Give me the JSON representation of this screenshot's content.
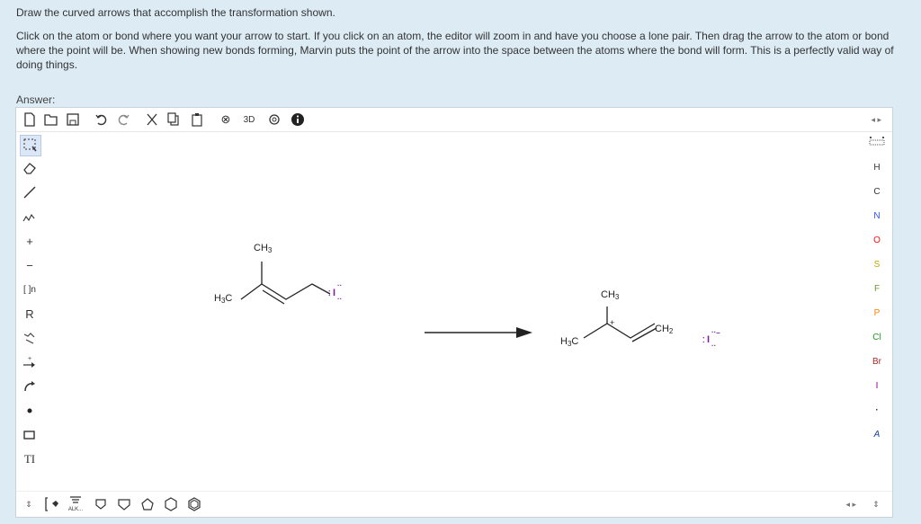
{
  "question": {
    "line1": "Draw the curved arrows that accomplish the transformation shown.",
    "line2": "Click on the atom or bond where you want your arrow to start. If you click on an atom, the editor will zoom in and have you choose a lone pair. Then drag the arrow to the atom or bond where the point will be. When showing new bonds forming, Marvin puts the point of the arrow into the space between the atoms where the bond will form. This is a perfectly valid way of doing things."
  },
  "answer_label": "Answer:",
  "toolbar": {
    "icons": [
      "new-document-icon",
      "open-folder-icon",
      "save-icon",
      "undo-icon",
      "redo-icon",
      "cut-icon",
      "copy-icon",
      "paste-icon",
      "zoom-icon",
      "3d-icon",
      "settings-icon",
      "info-icon"
    ],
    "zoom_label": "⊗",
    "threed_label": "3D",
    "nav_label": "◂ ▸"
  },
  "leftbar": {
    "icons": [
      "selection-icon",
      "eraser-icon",
      "single-bond-icon",
      "chain-icon",
      "plus-charge-icon",
      "minus-charge-icon",
      "bracket-icon",
      "r-group-icon",
      "hydrogen-icon",
      "reaction-arrow-icon",
      "curved-arrow-icon",
      "radical-icon",
      "shape-icon",
      "text-icon"
    ],
    "plus": "+",
    "minus": "−",
    "bracket": "[ ]n",
    "rgroup": "R",
    "text": "TI"
  },
  "rightbar": {
    "elements": [
      "H",
      "C",
      "N",
      "O",
      "S",
      "F",
      "P",
      "Cl",
      "Br",
      "I",
      "·",
      "A"
    ],
    "colors": {
      "N": "#3050f8",
      "O": "#ff0d0d",
      "S": "#c8a000",
      "F": "#6a9c2e",
      "P": "#ff8000",
      "Cl": "#1fa01f",
      "Br": "#a62929",
      "I": "#940094",
      "A": "#0f3e9e"
    }
  },
  "bottombar": {
    "alk_label": "ALK...",
    "nav_label": "◂ ▸"
  },
  "molecules": {
    "reactant": {
      "ch3": "CH",
      "ch3_sub": "3",
      "h3c": "H",
      "h3c_sub": "3",
      "h3c_c": "C",
      "iodine": "I"
    },
    "product": {
      "ch3": "CH",
      "ch3_sub": "3",
      "h3c": "H",
      "h3c_sub": "3",
      "h3c_c": "C",
      "ch2": "CH",
      "ch2_sub": "2",
      "plus": "+",
      "iodide": "I",
      "iodide_charge": "−"
    }
  }
}
